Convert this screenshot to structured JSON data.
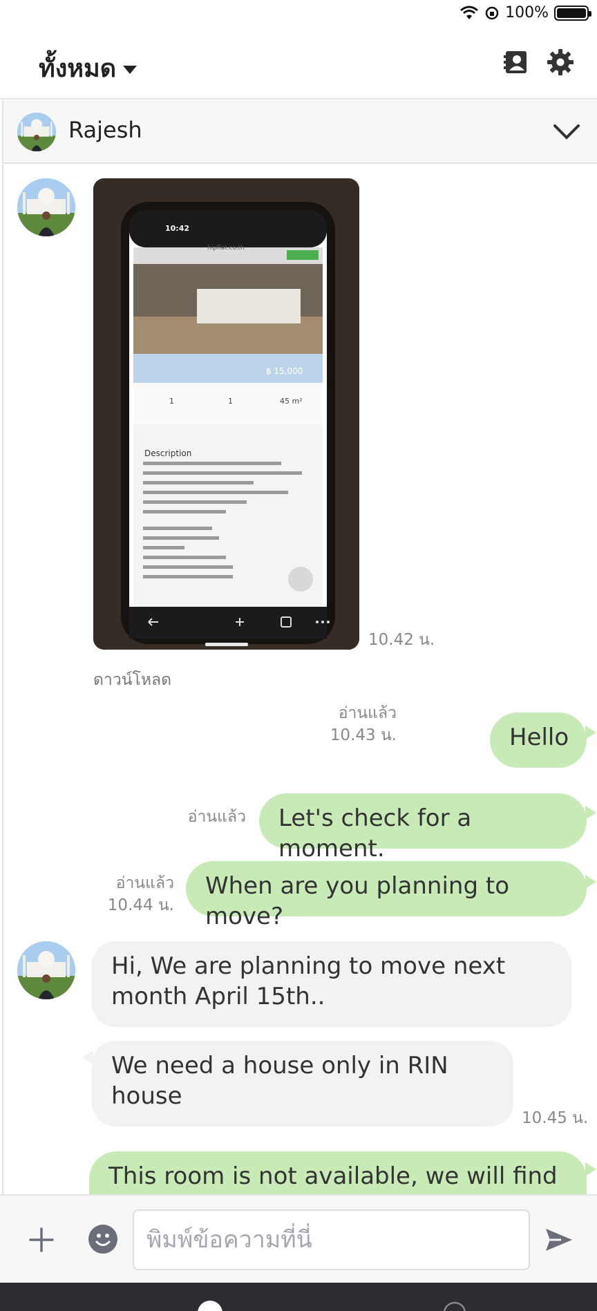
{
  "status": {
    "battery_text": "100%",
    "icons": [
      "wifi-icon",
      "orientation-lock-icon",
      "battery-icon"
    ]
  },
  "header": {
    "title": "ทั้งหมด",
    "icons": [
      "contacts-icon",
      "settings-gear-icon"
    ]
  },
  "chat": {
    "partner_name": "Rajesh"
  },
  "messages": {
    "photo": {
      "time": "10.42 น.",
      "download_label": "ดาวน์โหลด",
      "screen": {
        "clock": "10:42",
        "url": "hipflat.co.th",
        "price": "฿ 15,000",
        "stats": [
          "1",
          "1",
          "45 m²"
        ],
        "heading": "Description"
      }
    },
    "m1": {
      "text": "Hello",
      "read": "อ่านแล้ว",
      "time": "10.43 น."
    },
    "m2": {
      "text": "Let's check for a moment.",
      "read": "อ่านแล้ว"
    },
    "m3": {
      "text": "When are you planning to move?",
      "read": "อ่านแล้ว",
      "time": "10.44 น."
    },
    "m4": {
      "line1": "Hi, We are planning to move next",
      "line2": "month April 15th.."
    },
    "m5": {
      "line1": "We need a house only in RIN",
      "line2": "house",
      "time": "10.45 น."
    },
    "m6": {
      "text": "This room is not available, we will find"
    }
  },
  "composer": {
    "placeholder": "พิมพ์ข้อความที่นี่"
  },
  "colors": {
    "outgoing_bubble": "#c7eab6",
    "incoming_bubble": "#f1f2f4",
    "icon_gray": "#6a6d7a"
  }
}
